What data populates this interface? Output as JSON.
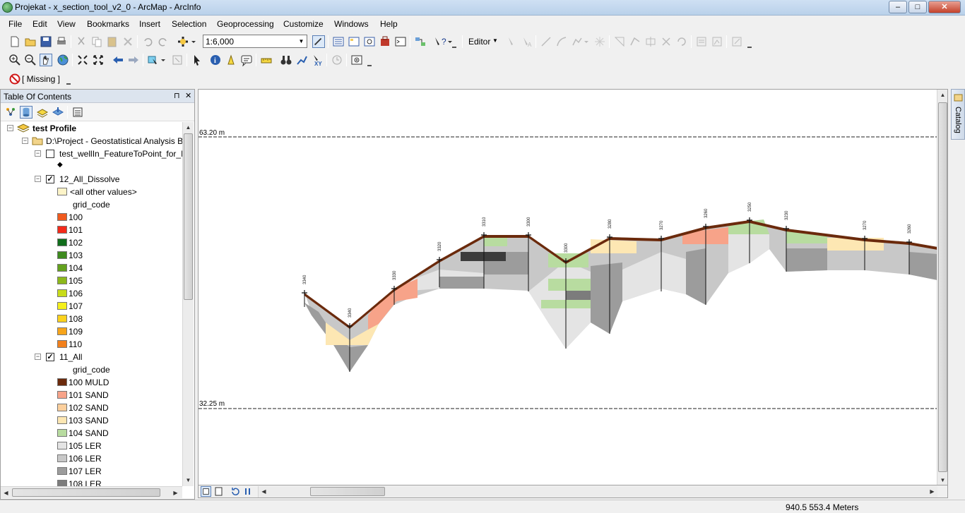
{
  "window": {
    "title": "Projekat - x_section_tool_v2_0 - ArcMap - ArcInfo",
    "buttons": {
      "minimize": "–",
      "maximize": "□",
      "close": "✕"
    }
  },
  "menubar": [
    "File",
    "Edit",
    "View",
    "Bookmarks",
    "Insert",
    "Selection",
    "Geoprocessing",
    "Customize",
    "Windows",
    "Help"
  ],
  "standard_toolbar": {
    "scale": "1:6,000",
    "editor_label": "Editor"
  },
  "tools_toolbar": {},
  "missing_toolbar": {
    "label": "[ Missing ]"
  },
  "toc": {
    "title": "Table Of Contents",
    "pin": "⊓",
    "close": "✕",
    "root": "test Profile",
    "folder": "D:\\Project - Geostatistical Analysis B",
    "layer1": {
      "name": "test_wellIn_FeatureToPoint_for_L",
      "checked": false,
      "symbol": "◆"
    },
    "layer2": {
      "name": "12_All_Dissolve",
      "checked": true,
      "other_label": "<all other values>",
      "field": "grid_code",
      "classes": [
        {
          "label": "100",
          "color": "#f05a1e"
        },
        {
          "label": "101",
          "color": "#f42a1a"
        },
        {
          "label": "102",
          "color": "#116e1c"
        },
        {
          "label": "103",
          "color": "#3e8a1e"
        },
        {
          "label": "104",
          "color": "#63a11d"
        },
        {
          "label": "105",
          "color": "#8db81b"
        },
        {
          "label": "106",
          "color": "#c8dc1a"
        },
        {
          "label": "107",
          "color": "#f5f01c"
        },
        {
          "label": "108",
          "color": "#fcd21d"
        },
        {
          "label": "109",
          "color": "#f7a51b"
        },
        {
          "label": "110",
          "color": "#f2801c"
        }
      ]
    },
    "layer3": {
      "name": "11_All",
      "checked": true,
      "field": "grid_code",
      "classes": [
        {
          "label": "100 MULD",
          "color": "#6b2a0c"
        },
        {
          "label": "101 SAND",
          "color": "#f7a389"
        },
        {
          "label": "102 SAND",
          "color": "#fccf9c"
        },
        {
          "label": "103 SAND",
          "color": "#fde7b3"
        },
        {
          "label": "104 SAND",
          "color": "#b8dca0"
        },
        {
          "label": "105 LER",
          "color": "#e4e4e4"
        },
        {
          "label": "106 LER",
          "color": "#c8c8c8"
        },
        {
          "label": "107 LER",
          "color": "#9c9c9c"
        },
        {
          "label": "108 LER",
          "color": "#7c7c7c"
        }
      ]
    }
  },
  "map": {
    "top_level_label": "63.20 m",
    "bottom_level_label": "32.25 m",
    "well_labels": [
      "3340",
      "3340",
      "3330",
      "3320",
      "3310",
      "3300",
      "3300",
      "3280",
      "3270",
      "3260",
      "3250",
      "3230",
      "3270",
      "3260"
    ],
    "colors": {
      "muld": "#6b2a0c",
      "sand_orange": "#f7a389",
      "sand_yellow": "#fde7b3",
      "sand_green": "#b8dca0",
      "ler_light": "#e4e4e4",
      "ler_mid": "#c8c8c8",
      "ler_dark": "#9c9c9c",
      "ler_darker": "#7c7c7c",
      "ler_darkest": "#3c3c3c"
    }
  },
  "catalog_tab": "Catalog",
  "status": {
    "coordinates": "940.5  553.4 Meters"
  }
}
